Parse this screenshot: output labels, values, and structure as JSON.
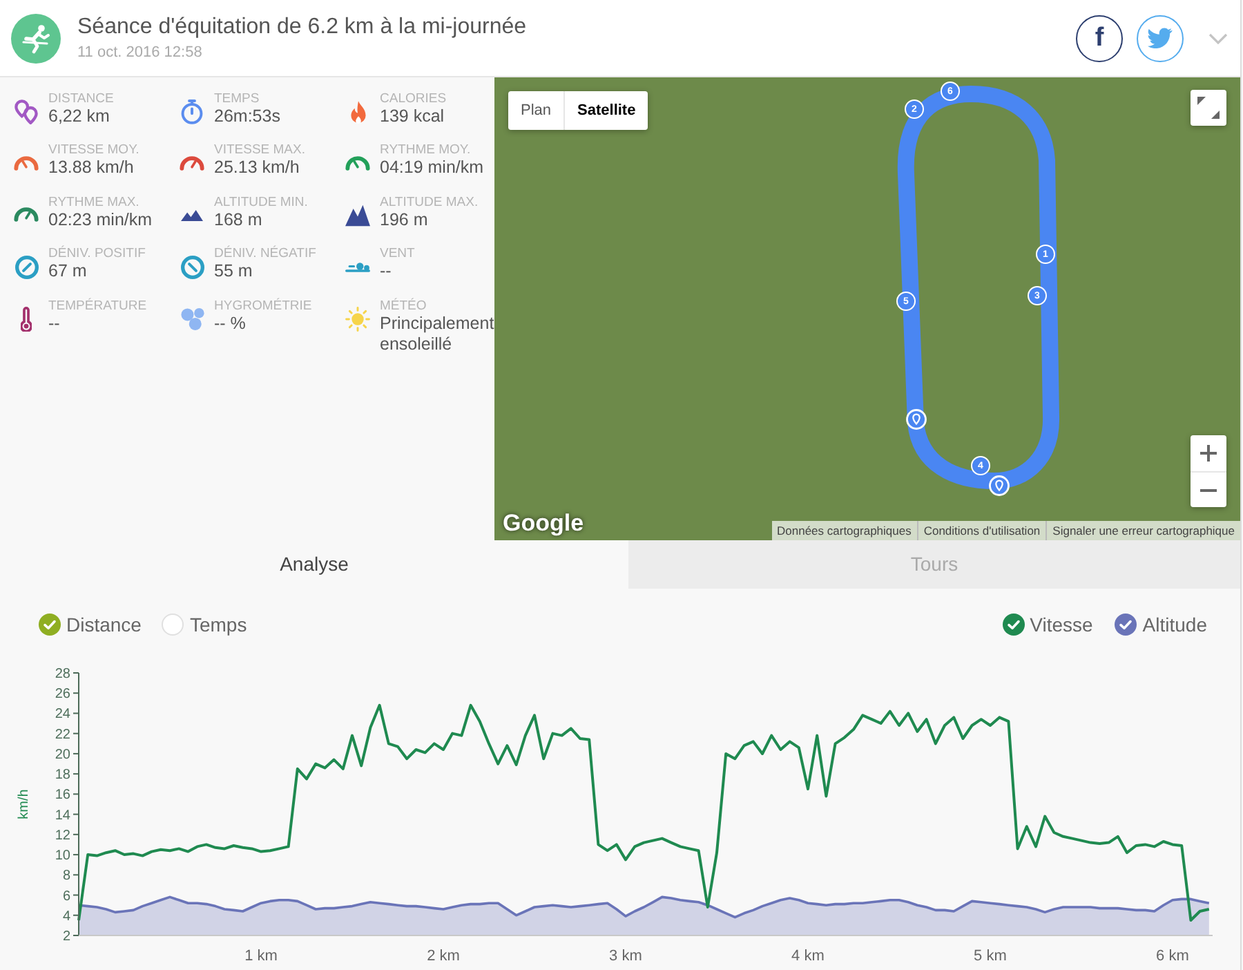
{
  "header": {
    "title": "Séance d'équitation de 6.2 km à la mi-journée",
    "date": "11 oct. 2016 12:58",
    "share_buttons": [
      {
        "kind": "facebook",
        "label": "f"
      },
      {
        "kind": "twitter"
      }
    ]
  },
  "stats": [
    {
      "label": "DISTANCE",
      "value": "6,22 km"
    },
    {
      "label": "TEMPS",
      "value": "26m:53s"
    },
    {
      "label": "CALORIES",
      "value": "139 kcal"
    },
    {
      "label": "VITESSE MOY.",
      "value": "13.88 km/h"
    },
    {
      "label": "VITESSE MAX.",
      "value": "25.13 km/h"
    },
    {
      "label": "RYTHME MOY.",
      "value": "04:19 min/km"
    },
    {
      "label": "RYTHME MAX.",
      "value": "02:23 min/km"
    },
    {
      "label": "ALTITUDE MIN.",
      "value": "168 m"
    },
    {
      "label": "ALTITUDE MAX.",
      "value": "196 m"
    },
    {
      "label": "DÉNIV. POSITIF",
      "value": "67 m"
    },
    {
      "label": "DÉNIV. NÉGATIF",
      "value": "55 m"
    },
    {
      "label": "VENT",
      "value": "--"
    },
    {
      "label": "TEMPÉRATURE",
      "value": "--"
    },
    {
      "label": "HYGROMÉTRIE",
      "value": "-- %"
    },
    {
      "label": "MÉTÉO",
      "value": "Principalement ensoleillé"
    }
  ],
  "map": {
    "map_types": [
      {
        "label": "Plan",
        "selected": false
      },
      {
        "label": "Satellite",
        "selected": true
      }
    ],
    "markers": [
      {
        "kind": "km",
        "label": "6"
      },
      {
        "kind": "km",
        "label": "2"
      },
      {
        "kind": "km",
        "label": "1"
      },
      {
        "kind": "km",
        "label": "3"
      },
      {
        "kind": "km",
        "label": "5"
      },
      {
        "kind": "pin"
      },
      {
        "kind": "km",
        "label": "4"
      },
      {
        "kind": "pin"
      }
    ],
    "logo": "Google",
    "footer_links": [
      "Données cartographiques",
      "Conditions d'utilisation",
      "Signaler une erreur cartographique"
    ]
  },
  "tabs": [
    {
      "label": "Analyse",
      "selected": true
    },
    {
      "label": "Tours",
      "selected": false
    }
  ],
  "x_axis_options": [
    {
      "label": "Distance",
      "selected": true
    },
    {
      "label": "Temps",
      "selected": false
    }
  ],
  "legend": [
    {
      "label": "Vitesse",
      "checked": true,
      "color": "#1f8a50"
    },
    {
      "label": "Altitude",
      "checked": true,
      "color": "#6a74b8"
    }
  ],
  "chart_data": {
    "type": "line",
    "ylabel": "km/h",
    "x": [
      0,
      0.05,
      0.1,
      0.15,
      0.2,
      0.25,
      0.3,
      0.35,
      0.4,
      0.45,
      0.5,
      0.55,
      0.6,
      0.65,
      0.7,
      0.75,
      0.8,
      0.85,
      0.9,
      0.95,
      1,
      1.05,
      1.1,
      1.15,
      1.2,
      1.25,
      1.3,
      1.35,
      1.4,
      1.45,
      1.5,
      1.55,
      1.6,
      1.65,
      1.7,
      1.75,
      1.8,
      1.85,
      1.9,
      1.95,
      2,
      2.05,
      2.1,
      2.15,
      2.2,
      2.25,
      2.3,
      2.35,
      2.4,
      2.45,
      2.5,
      2.55,
      2.6,
      2.65,
      2.7,
      2.75,
      2.8,
      2.85,
      2.9,
      2.95,
      3,
      3.05,
      3.1,
      3.15,
      3.2,
      3.25,
      3.3,
      3.35,
      3.4,
      3.45,
      3.5,
      3.55,
      3.6,
      3.65,
      3.7,
      3.75,
      3.8,
      3.85,
      3.9,
      3.95,
      4,
      4.05,
      4.1,
      4.15,
      4.2,
      4.25,
      4.3,
      4.35,
      4.4,
      4.45,
      4.5,
      4.55,
      4.6,
      4.65,
      4.7,
      4.75,
      4.8,
      4.85,
      4.9,
      4.95,
      5,
      5.05,
      5.1,
      5.15,
      5.2,
      5.25,
      5.3,
      5.35,
      5.4,
      5.45,
      5.5,
      5.55,
      5.6,
      5.65,
      5.7,
      5.75,
      5.8,
      5.85,
      5.9,
      5.95,
      6,
      6.05,
      6.1,
      6.15,
      6.2
    ],
    "series": [
      {
        "color": "#1f8a50",
        "values": [
          3.5,
          10.0,
          9.9,
          10.2,
          10.4,
          10.0,
          10.1,
          9.9,
          10.3,
          10.5,
          10.4,
          10.6,
          10.3,
          10.8,
          11.0,
          10.7,
          10.6,
          10.9,
          10.7,
          10.6,
          10.3,
          10.4,
          10.6,
          10.8,
          18.5,
          17.5,
          19.0,
          18.6,
          19.4,
          18.5,
          21.8,
          18.8,
          22.6,
          24.8,
          21.0,
          20.7,
          19.5,
          20.4,
          20.1,
          21.0,
          20.4,
          22.0,
          21.8,
          24.8,
          23.2,
          21.0,
          19.0,
          20.8,
          18.9,
          21.8,
          23.8,
          19.5,
          22.0,
          21.8,
          22.5,
          21.5,
          21.4,
          11.0,
          10.4,
          11.0,
          9.5,
          10.8,
          11.2,
          11.4,
          11.6,
          11.2,
          10.8,
          10.6,
          10.4,
          4.8,
          10.2,
          20.0,
          19.5,
          20.8,
          21.2,
          20.0,
          21.8,
          20.4,
          21.2,
          20.6,
          16.5,
          21.8,
          15.8,
          21.0,
          21.6,
          22.4,
          23.8,
          23.4,
          23.0,
          24.2,
          22.8,
          24.0,
          22.2,
          23.4,
          21.0,
          22.8,
          23.6,
          21.5,
          22.8,
          23.4,
          22.8,
          23.6,
          23.2,
          10.6,
          12.8,
          10.8,
          13.8,
          12.2,
          11.8,
          11.6,
          11.4,
          11.2,
          11.1,
          11.2,
          11.8,
          10.2,
          10.9,
          11.0,
          10.8,
          11.3,
          11.0,
          10.9,
          3.5,
          4.4,
          4.6
        ]
      },
      {
        "color": "#6a74b8",
        "type": "area",
        "values": [
          5.0,
          4.9,
          4.8,
          4.6,
          4.3,
          4.4,
          4.5,
          4.9,
          5.2,
          5.5,
          5.8,
          5.5,
          5.2,
          5.2,
          5.1,
          4.9,
          4.6,
          4.5,
          4.4,
          4.8,
          5.2,
          5.4,
          5.5,
          5.5,
          5.4,
          5.0,
          4.6,
          4.7,
          4.7,
          4.8,
          4.9,
          5.1,
          5.3,
          5.2,
          5.1,
          5.0,
          4.9,
          4.9,
          4.8,
          4.7,
          4.6,
          4.8,
          5.0,
          5.1,
          5.1,
          5.2,
          5.2,
          4.6,
          4.0,
          4.4,
          4.8,
          4.9,
          5.0,
          4.9,
          4.8,
          4.9,
          5.0,
          5.1,
          5.2,
          4.6,
          3.9,
          4.4,
          4.8,
          5.3,
          5.8,
          5.7,
          5.5,
          5.4,
          5.3,
          5.0,
          4.6,
          4.2,
          3.8,
          4.2,
          4.5,
          4.9,
          5.2,
          5.5,
          5.7,
          5.5,
          5.2,
          5.1,
          5.0,
          5.1,
          5.1,
          5.2,
          5.2,
          5.3,
          5.4,
          5.5,
          5.5,
          5.3,
          5.0,
          4.8,
          4.5,
          4.5,
          4.4,
          4.9,
          5.4,
          5.3,
          5.2,
          5.1,
          5.0,
          4.9,
          4.8,
          4.6,
          4.3,
          4.6,
          4.8,
          4.8,
          4.8,
          4.8,
          4.7,
          4.7,
          4.7,
          4.6,
          4.5,
          4.5,
          4.4,
          5.0,
          5.5,
          5.6,
          5.6,
          5.4,
          5.2
        ]
      }
    ],
    "xlim": [
      0,
      6.22
    ],
    "ylim": [
      2,
      28
    ],
    "xticks": [
      {
        "value": 1,
        "label": "1 km"
      },
      {
        "value": 2,
        "label": "2 km"
      },
      {
        "value": 3,
        "label": "3 km"
      },
      {
        "value": 4,
        "label": "4 km"
      },
      {
        "value": 5,
        "label": "5 km"
      },
      {
        "value": 6,
        "label": "6 km"
      }
    ],
    "yticks": [
      2,
      4,
      6,
      8,
      10,
      12,
      14,
      16,
      18,
      20,
      22,
      24,
      26,
      28
    ]
  }
}
